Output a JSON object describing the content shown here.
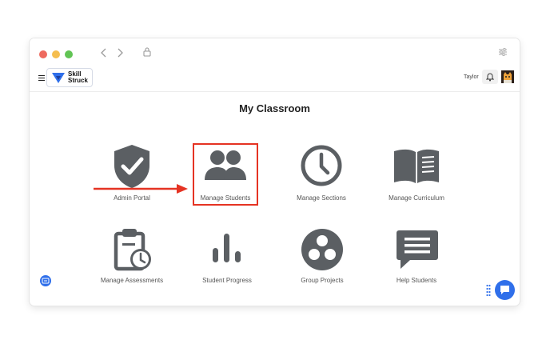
{
  "header": {
    "user_name": "Taylor",
    "logo_line1": "Skill",
    "logo_line2": "Struck"
  },
  "page": {
    "title": "My Classroom"
  },
  "tiles": [
    {
      "label": "Admin Portal",
      "icon": "shield-check-icon"
    },
    {
      "label": "Manage Students",
      "icon": "users-icon"
    },
    {
      "label": "Manage Sections",
      "icon": "clock-icon"
    },
    {
      "label": "Manage Curriculum",
      "icon": "book-icon"
    },
    {
      "label": "Manage Assessments",
      "icon": "clipboard-clock-icon"
    },
    {
      "label": "Student Progress",
      "icon": "bar-chart-icon"
    },
    {
      "label": "Group Projects",
      "icon": "group-icon"
    },
    {
      "label": "Help Students",
      "icon": "chat-icon"
    }
  ],
  "colors": {
    "icon": "#5b5f63",
    "highlight": "#e53323",
    "accent": "#2f6fea"
  }
}
